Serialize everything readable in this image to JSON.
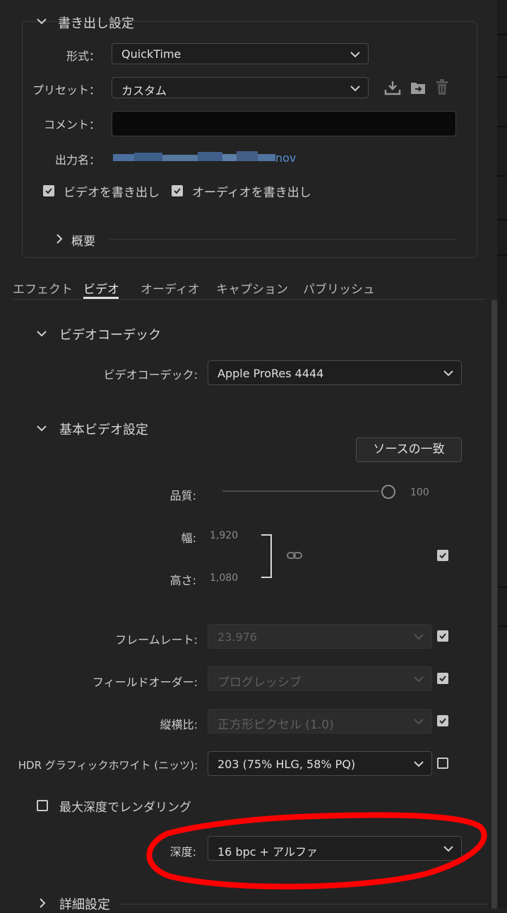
{
  "export_settings": {
    "title": "書き出し設定",
    "format_label": "形式",
    "format_value": "QuickTime",
    "preset_label": "プリセット",
    "preset_value": "カスタム",
    "comment_label": "コメント",
    "comment_value": "",
    "output_label": "出力名",
    "output_value": "nov",
    "export_video_label": "ビデオを書き出し",
    "export_video_checked": true,
    "export_audio_label": "オーディオを書き出し",
    "export_audio_checked": true,
    "summary_label": "概要"
  },
  "tabs": [
    {
      "label": "エフェクト",
      "active": false
    },
    {
      "label": "ビデオ",
      "active": true
    },
    {
      "label": "オーディオ",
      "active": false
    },
    {
      "label": "キャプション",
      "active": false
    },
    {
      "label": "パブリッシュ",
      "active": false
    }
  ],
  "video_codec": {
    "section_title": "ビデオコーデック",
    "codec_label": "ビデオコーデック",
    "codec_value": "Apple ProRes 4444"
  },
  "basic_video": {
    "section_title": "基本ビデオ設定",
    "match_source_button": "ソースの一致",
    "quality_label": "品質",
    "quality_value": "100",
    "width_label": "幅",
    "width_value": "1,920",
    "height_label": "高さ",
    "height_value": "1,080",
    "link_checked": true,
    "framerate_label": "フレームレート",
    "framerate_value": "23.976",
    "framerate_checked": true,
    "field_order_label": "フィールドオーダー",
    "field_order_value": "プログレッシブ",
    "field_order_checked": true,
    "aspect_label": "縦横比",
    "aspect_value": "正方形ピクセル (1.0)",
    "aspect_checked": true,
    "hdr_label": "HDR グラフィックホワイト (ニッツ)",
    "hdr_value": "203 (75% HLG, 58% PQ)",
    "hdr_checked": false,
    "max_depth_label": "最大深度でレンダリング",
    "max_depth_checked": false,
    "depth_label": "深度",
    "depth_value": "16 bpc + アルファ"
  },
  "advanced_label": "詳細設定",
  "colors": {
    "background": "#232323",
    "annotation_red": "#ff0000",
    "link_blue": "#5a8fd6"
  }
}
